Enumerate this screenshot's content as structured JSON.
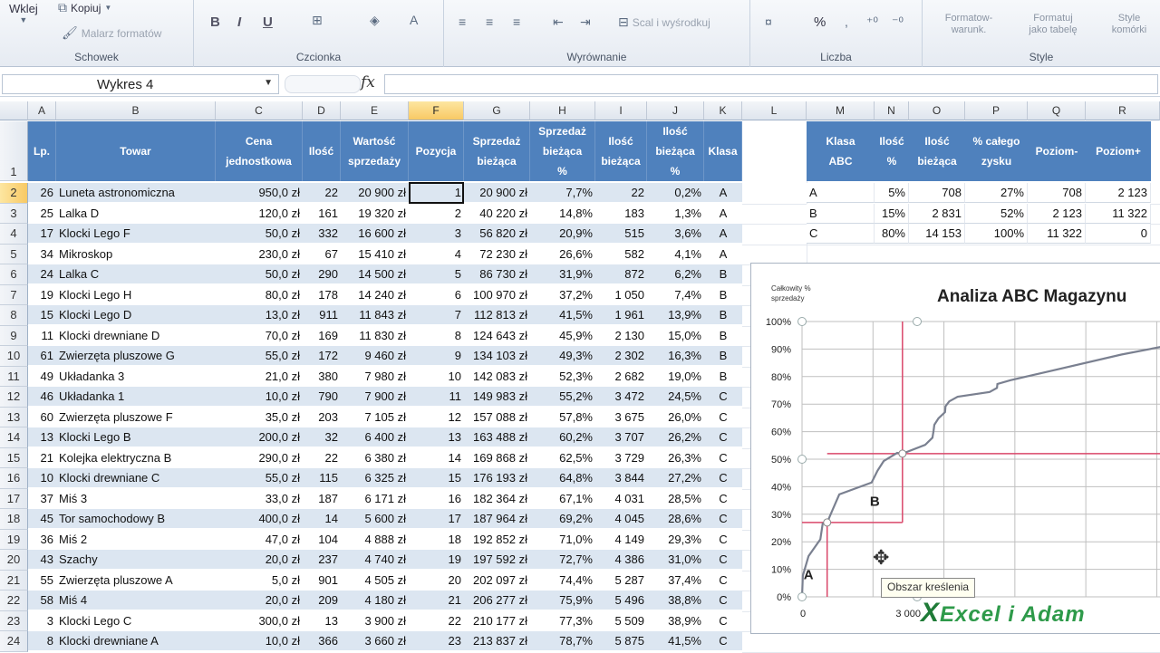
{
  "ribbon": {
    "clipboard": {
      "label": "Schowek",
      "paste": "Wklej",
      "copy": "Kopiuj",
      "format_painter": "Malarz formatów"
    },
    "font": {
      "label": "Czcionka"
    },
    "alignment": {
      "label": "Wyrównanie",
      "merge": "Scal i wyśrodkuj"
    },
    "number": {
      "label": "Liczba",
      "percent": "%"
    },
    "styles": {
      "label": "Style",
      "conditional": "Formatow-\nwarunk.",
      "as_table": "Formatuj\njako tabelę",
      "cell_styles": "Style\nkomórki"
    }
  },
  "formula_bar": {
    "name_box": "Wykres 4",
    "fx": "fx",
    "content": ""
  },
  "columns": [
    "A",
    "B",
    "C",
    "D",
    "E",
    "F",
    "G",
    "H",
    "I",
    "J",
    "K",
    "L",
    "M",
    "N",
    "O",
    "P",
    "Q",
    "R"
  ],
  "selected_column": "F",
  "selected_row": "2",
  "header_row": {
    "number": "1",
    "cells": [
      "Lp.",
      "Towar",
      "Cena\njednostkowa",
      "Ilość",
      "Wartość\nsprzedaży",
      "Pozycja",
      "Sprzedaż\nbieżąca",
      "Sprzedaż\nbieżąca\n%",
      "Ilość\nbieżąca",
      "Ilość\nbieżąca\n%",
      "Klasa"
    ]
  },
  "rows": [
    [
      "2",
      "26",
      "Luneta astronomiczna",
      "950,0 zł",
      "22",
      "20 900 zł",
      "1",
      "20 900 zł",
      "7,7%",
      "22",
      "0,2%",
      "A"
    ],
    [
      "3",
      "25",
      "Lalka D",
      "120,0 zł",
      "161",
      "19 320 zł",
      "2",
      "40 220 zł",
      "14,8%",
      "183",
      "1,3%",
      "A"
    ],
    [
      "4",
      "17",
      "Klocki Lego F",
      "50,0 zł",
      "332",
      "16 600 zł",
      "3",
      "56 820 zł",
      "20,9%",
      "515",
      "3,6%",
      "A"
    ],
    [
      "5",
      "34",
      "Mikroskop",
      "230,0 zł",
      "67",
      "15 410 zł",
      "4",
      "72 230 zł",
      "26,6%",
      "582",
      "4,1%",
      "A"
    ],
    [
      "6",
      "24",
      "Lalka C",
      "50,0 zł",
      "290",
      "14 500 zł",
      "5",
      "86 730 zł",
      "31,9%",
      "872",
      "6,2%",
      "B"
    ],
    [
      "7",
      "19",
      "Klocki Lego H",
      "80,0 zł",
      "178",
      "14 240 zł",
      "6",
      "100 970 zł",
      "37,2%",
      "1 050",
      "7,4%",
      "B"
    ],
    [
      "8",
      "15",
      "Klocki Lego D",
      "13,0 zł",
      "911",
      "11 843 zł",
      "7",
      "112 813 zł",
      "41,5%",
      "1 961",
      "13,9%",
      "B"
    ],
    [
      "9",
      "11",
      "Klocki drewniane D",
      "70,0 zł",
      "169",
      "11 830 zł",
      "8",
      "124 643 zł",
      "45,9%",
      "2 130",
      "15,0%",
      "B"
    ],
    [
      "10",
      "61",
      "Zwierzęta pluszowe G",
      "55,0 zł",
      "172",
      "9 460 zł",
      "9",
      "134 103 zł",
      "49,3%",
      "2 302",
      "16,3%",
      "B"
    ],
    [
      "11",
      "49",
      "Układanka 3",
      "21,0 zł",
      "380",
      "7 980 zł",
      "10",
      "142 083 zł",
      "52,3%",
      "2 682",
      "19,0%",
      "B"
    ],
    [
      "12",
      "46",
      "Układanka 1",
      "10,0 zł",
      "790",
      "7 900 zł",
      "11",
      "149 983 zł",
      "55,2%",
      "3 472",
      "24,5%",
      "C"
    ],
    [
      "13",
      "60",
      "Zwierzęta pluszowe F",
      "35,0 zł",
      "203",
      "7 105 zł",
      "12",
      "157 088 zł",
      "57,8%",
      "3 675",
      "26,0%",
      "C"
    ],
    [
      "14",
      "13",
      "Klocki Lego B",
      "200,0 zł",
      "32",
      "6 400 zł",
      "13",
      "163 488 zł",
      "60,2%",
      "3 707",
      "26,2%",
      "C"
    ],
    [
      "15",
      "21",
      "Kolejka elektryczna B",
      "290,0 zł",
      "22",
      "6 380 zł",
      "14",
      "169 868 zł",
      "62,5%",
      "3 729",
      "26,3%",
      "C"
    ],
    [
      "16",
      "10",
      "Klocki drewniane C",
      "55,0 zł",
      "115",
      "6 325 zł",
      "15",
      "176 193 zł",
      "64,8%",
      "3 844",
      "27,2%",
      "C"
    ],
    [
      "17",
      "37",
      "Miś 3",
      "33,0 zł",
      "187",
      "6 171 zł",
      "16",
      "182 364 zł",
      "67,1%",
      "4 031",
      "28,5%",
      "C"
    ],
    [
      "18",
      "45",
      "Tor samochodowy B",
      "400,0 zł",
      "14",
      "5 600 zł",
      "17",
      "187 964 zł",
      "69,2%",
      "4 045",
      "28,6%",
      "C"
    ],
    [
      "19",
      "36",
      "Miś 2",
      "47,0 zł",
      "104",
      "4 888 zł",
      "18",
      "192 852 zł",
      "71,0%",
      "4 149",
      "29,3%",
      "C"
    ],
    [
      "20",
      "43",
      "Szachy",
      "20,0 zł",
      "237",
      "4 740 zł",
      "19",
      "197 592 zł",
      "72,7%",
      "4 386",
      "31,0%",
      "C"
    ],
    [
      "21",
      "55",
      "Zwierzęta pluszowe A",
      "5,0 zł",
      "901",
      "4 505 zł",
      "20",
      "202 097 zł",
      "74,4%",
      "5 287",
      "37,4%",
      "C"
    ],
    [
      "22",
      "58",
      "Miś 4",
      "20,0 zł",
      "209",
      "4 180 zł",
      "21",
      "206 277 zł",
      "75,9%",
      "5 496",
      "38,8%",
      "C"
    ],
    [
      "23",
      "3",
      "Klocki Lego C",
      "300,0 zł",
      "13",
      "3 900 zł",
      "22",
      "210 177 zł",
      "77,3%",
      "5 509",
      "38,9%",
      "C"
    ],
    [
      "24",
      "8",
      "Klocki drewniane A",
      "10,0 zł",
      "366",
      "3 660 zł",
      "23",
      "213 837 zł",
      "78,7%",
      "5 875",
      "41,5%",
      "C"
    ]
  ],
  "abc_table": {
    "headers": [
      "Klasa\nABC",
      "Ilość\n%",
      "Ilość\nbieżąca",
      "% całego\nzysku",
      "Poziom-",
      "Poziom+"
    ],
    "rows": [
      [
        "A",
        "5%",
        "708",
        "27%",
        "708",
        "2 123"
      ],
      [
        "B",
        "15%",
        "2 831",
        "52%",
        "2 123",
        "11 322"
      ],
      [
        "C",
        "80%",
        "14 153",
        "100%",
        "11 322",
        "0"
      ]
    ]
  },
  "chart_data": {
    "type": "line",
    "title": "Analiza ABC Magazynu",
    "ylabel": "Całkowity %\nsprzedaży",
    "yticks": [
      "0%",
      "10%",
      "20%",
      "30%",
      "40%",
      "50%",
      "60%",
      "70%",
      "80%",
      "90%",
      "100%"
    ],
    "xticks": [
      "0",
      "3 000"
    ],
    "ylim": [
      0,
      100
    ],
    "xlim": [
      0,
      14153
    ],
    "series": [
      {
        "x": [
          0,
          22,
          183,
          515,
          582,
          708,
          872,
          1050,
          1961,
          2130,
          2302,
          2682,
          2831,
          3472,
          3675,
          3707,
          3729,
          3844,
          4031,
          4045,
          4149,
          4386,
          5287,
          5496,
          5509,
          5875,
          7000,
          9000,
          11000,
          14153
        ],
        "y": [
          0,
          7.7,
          14.8,
          20.9,
          26.6,
          27,
          31.9,
          37.2,
          41.5,
          45.9,
          49.3,
          52.3,
          52,
          55.2,
          57.8,
          60.2,
          62.5,
          64.8,
          67.1,
          69.2,
          71.0,
          72.7,
          74.4,
          75.9,
          77.3,
          78.7,
          82,
          88,
          93,
          100
        ]
      }
    ],
    "region_labels": [
      "A",
      "B"
    ],
    "boundaries": {
      "a_qty": 708,
      "a_pct": 27,
      "b_qty": 2831,
      "b_pct": 52
    },
    "colors": {
      "series": "#7a8090",
      "boundary": "#d9476a",
      "grid": "#bfbfbf"
    }
  },
  "tooltip": "Obszar kreślenia",
  "watermark": {
    "mark": "X",
    "text": "Excel i Adam"
  }
}
